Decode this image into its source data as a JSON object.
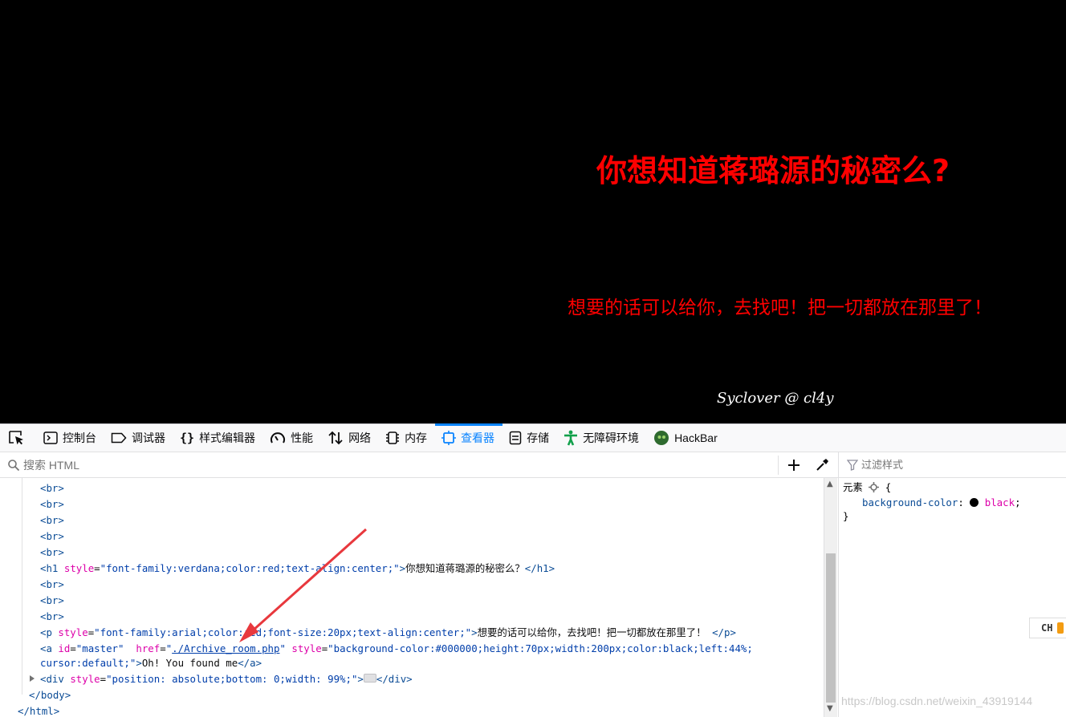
{
  "page": {
    "heading": "你想知道蒋璐源的秘密么?",
    "paragraph": "想要的话可以给你，去找吧！把一切都放在那里了！",
    "signature": "Syclover @ cl4y"
  },
  "devtools": {
    "tabs": [
      {
        "label": "控制台",
        "icon": "console-icon"
      },
      {
        "label": "调试器",
        "icon": "debugger-icon"
      },
      {
        "label": "样式编辑器",
        "icon": "braces-icon"
      },
      {
        "label": "性能",
        "icon": "performance-gauge-icon"
      },
      {
        "label": "网络",
        "icon": "network-arrows-icon"
      },
      {
        "label": "内存",
        "icon": "memory-chip-icon"
      },
      {
        "label": "查看器",
        "icon": "inspector-icon",
        "active": true
      },
      {
        "label": "存储",
        "icon": "storage-icon"
      },
      {
        "label": "无障碍环境",
        "icon": "accessibility-icon"
      },
      {
        "label": "HackBar",
        "icon": "hackbar-logo-icon"
      }
    ],
    "search_placeholder": "搜索 HTML",
    "filter_placeholder": "过滤样式",
    "markup": {
      "br": "<br>",
      "h1_open": "<h1",
      "h1_style_attr": "style",
      "h1_style_val": "\"font-family:verdana;color:red;text-align:center;\"",
      "h1_text": "你想知道蒋璐源的秘密么？",
      "h1_close": "</h1>",
      "p_open": "<p",
      "p_style_attr": "style",
      "p_style_val": "\"font-family:arial;color:red;font-size:20px;text-align:center;\"",
      "p_text": "想要的话可以给你，去找吧！把一切都放在那里了！",
      "p_close": "</p>",
      "a_open": "<a",
      "a_id_attr": "id",
      "a_id_val": "\"master\"",
      "a_href_attr": "href",
      "a_href_val": "./Archive_room.php",
      "a_style_attr": "style",
      "a_style_val": "\"background-color:#000000;height:70px;width:200px;color:black;left:44%;",
      "a_style_val2": "cursor:default;\"",
      "a_text": "Oh! You found me",
      "a_close": "</a>",
      "div_open": "<div",
      "div_style_attr": "style",
      "div_style_val": "\"position: absolute;bottom: 0;width: 99%;\"",
      "div_close": "</div>",
      "body_close": "</body>",
      "html_close": "</html>"
    },
    "rules": {
      "selector": "元素",
      "open_brace": "{",
      "property": "background-color",
      "value": "black",
      "swatch_color": "#000000",
      "close_brace": "}"
    }
  },
  "lang_badge": "CH",
  "watermark": "https://blog.csdn.net/weixin_43919144"
}
